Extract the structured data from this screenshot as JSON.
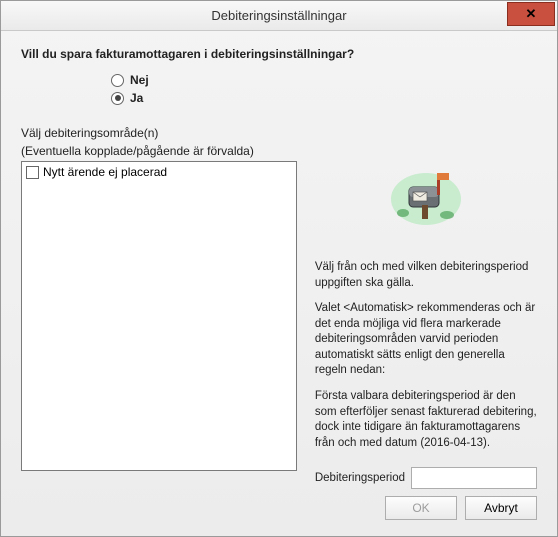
{
  "window": {
    "title": "Debiteringsinställningar",
    "close_glyph": "✕"
  },
  "question": "Vill du spara fakturamottagaren i debiteringsinställningar?",
  "radios": {
    "no_label": "Nej",
    "yes_label": "Ja",
    "selected": "yes"
  },
  "area_section": {
    "line1": "Välj debiteringsområde(n)",
    "line2": "(Eventuella kopplade/pågående är förvalda)"
  },
  "list": {
    "items": [
      {
        "label": "Nytt ärende ej placerad",
        "checked": false
      }
    ]
  },
  "info": {
    "p1": "Välj från och med vilken debiteringsperiod uppgiften ska gälla.",
    "p2": "Valet <Automatisk> rekommenderas och är det enda möjliga vid flera markerade debiteringsområden varvid perioden automatiskt sätts enligt den generella regeln nedan:",
    "p3": "Första valbara debiteringsperiod är den som efterföljer senast fakturerad debitering, dock inte tidigare än fakturamottagarens från och med datum (2016-04-13)."
  },
  "period": {
    "label": "Debiteringsperiod",
    "value": ""
  },
  "buttons": {
    "ok": "OK",
    "cancel": "Avbryt"
  },
  "icons": {
    "chevron_down": "˅"
  }
}
